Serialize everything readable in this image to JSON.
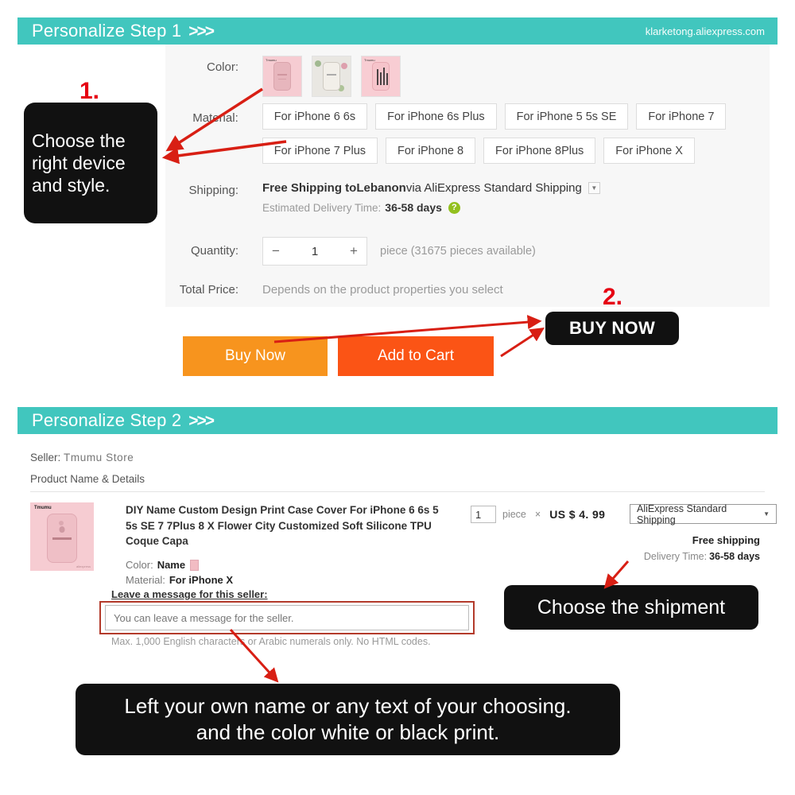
{
  "step1": {
    "header": {
      "title": "Personalize Step 1",
      "chevrons": ">>>",
      "domain": "klarketong.aliexpress.com"
    },
    "labels": {
      "color": "Color:",
      "material": "Material:",
      "shipping": "Shipping:",
      "quantity": "Quantity:",
      "total_price": "Total Price:"
    },
    "color_options": [
      {
        "name": "rose-gold-name-case",
        "alt": "Pink rose gold name case"
      },
      {
        "name": "floral-case",
        "alt": "Floral flower case"
      },
      {
        "name": "pink-city-case",
        "alt": "Pink city print case"
      }
    ],
    "material_options": [
      "For iPhone 6 6s",
      "For iPhone 6s Plus",
      "For iPhone 5 5s SE",
      "For iPhone 7",
      "For iPhone 7 Plus",
      "For iPhone 8",
      "For iPhone 8Plus",
      "For iPhone X"
    ],
    "shipping": {
      "free_text": "Free Shipping to ",
      "destination": "Lebanon",
      "via": " via AliExpress Standard Shipping",
      "dropdown_icon": "chevron-down-icon",
      "edt_label": "Estimated Delivery Time:",
      "edt_value": "36-58 days",
      "help_icon": "?"
    },
    "quantity": {
      "minus": "−",
      "value": "1",
      "plus": "+",
      "note": "piece (31675 pieces available)"
    },
    "total_price_value": "Depends on the product properties you select",
    "buttons": {
      "buy_now": "Buy Now",
      "add_to_cart": "Add to Cart"
    },
    "colors": {
      "header_teal": "#41c6be",
      "buy_now": "#f7941e",
      "add_to_cart": "#fb5415",
      "panel": "#f7f7f7"
    }
  },
  "annotations": {
    "marker_1": "1.",
    "marker_2": "2.",
    "callout_1": "Choose the right device and style.",
    "callout_2": "BUY NOW",
    "callout_3": "Choose the shipment",
    "callout_4_line1": "Left your own name or any text of your choosing.",
    "callout_4_line2": "and the color white or black print.",
    "arrow_color": "#d81f14"
  },
  "step2": {
    "header": {
      "title": "Personalize Step 2",
      "chevrons": ">>>"
    },
    "seller_label": "Seller:",
    "seller_name": "Tmumu Store",
    "product_name_details": "Product Name & Details",
    "product": {
      "title": "DIY Name Custom Design Print Case Cover For iPhone 6 6s 5 5s SE 7 7Plus 8 X Flower City Customized Soft Silicone TPU Coque Capa",
      "color_label": "Color:",
      "color_value": "Name",
      "material_label": "Material:",
      "material_value": "For iPhone X",
      "thumb_brand": "Tmumu"
    },
    "order": {
      "qty_value": "1",
      "piece_label": "piece",
      "times": "×",
      "price": "US $ 4. 99",
      "shipping_method": "AliExpress Standard Shipping",
      "shipping_dropdown_icon": "chevron-down-icon",
      "free_shipping": "Free shipping",
      "delivery_time_label": "Delivery Time:",
      "delivery_time_value": "36-58 days"
    },
    "message": {
      "label": "Leave a message for this seller:",
      "placeholder": "You can leave a message for the seller.",
      "hint": "Max. 1,000 English characters or Arabic numerals only. No HTML codes."
    }
  }
}
